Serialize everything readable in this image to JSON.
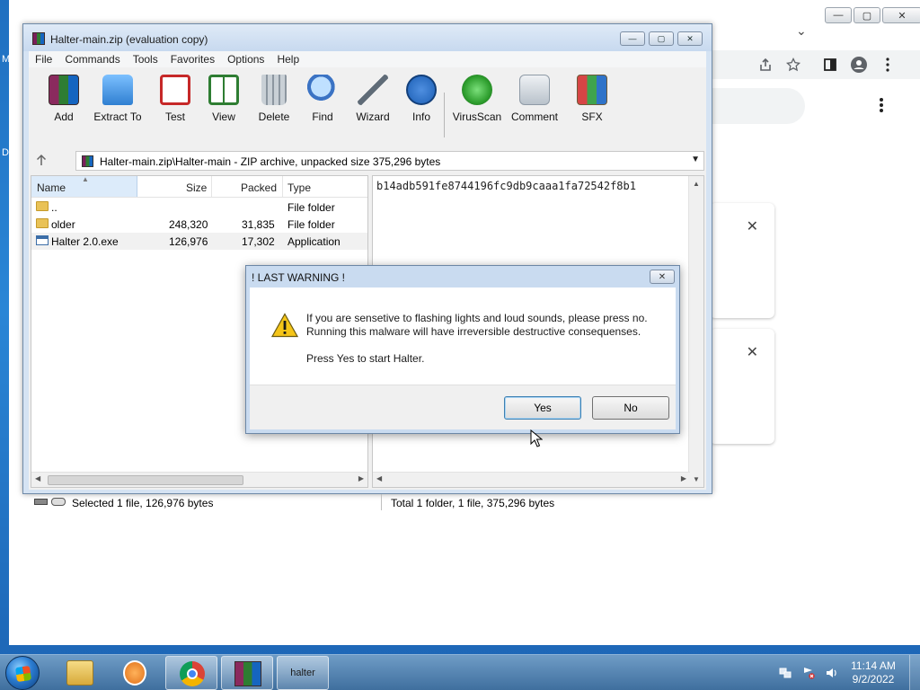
{
  "desktop": {
    "left_glyphs": [
      "M",
      "D"
    ]
  },
  "chrome": {
    "caption": {
      "minimize": "—",
      "maximize": "▢",
      "close": "✕"
    },
    "tab_strip_chevron": "⌄",
    "toolbar_icons": [
      "share-icon",
      "star-icon",
      "side-panel-icon",
      "profile-icon",
      "kebab-menu-icon"
    ],
    "cards": [
      {
        "close": "✕"
      },
      {
        "close": "✕"
      }
    ]
  },
  "winrar": {
    "title": "Halter-main.zip (evaluation copy)",
    "caption": {
      "minimize": "—",
      "maximize": "▢",
      "close": "✕"
    },
    "menu": [
      "File",
      "Commands",
      "Tools",
      "Favorites",
      "Options",
      "Help"
    ],
    "toolbar": [
      {
        "label": "Add",
        "icon": "archive-add-icon",
        "color": "#8a2a5e"
      },
      {
        "label": "Extract To",
        "icon": "folder-extract-icon",
        "color": "#2f7fd1"
      },
      {
        "label": "Test",
        "icon": "test-clipboard-icon",
        "color": "#c62828"
      },
      {
        "label": "View",
        "icon": "book-view-icon",
        "color": "#2e7d32"
      },
      {
        "label": "Delete",
        "icon": "trash-icon",
        "color": "#8c96a0"
      },
      {
        "label": "Find",
        "icon": "magnifier-icon",
        "color": "#3b73c4"
      },
      {
        "label": "Wizard",
        "icon": "wand-icon",
        "color": "#9aa7b3"
      },
      {
        "label": "Info",
        "icon": "info-icon",
        "color": "#1c5fb5"
      },
      {
        "label": "VirusScan",
        "icon": "virus-scan-icon",
        "color": "#2e9e2e"
      },
      {
        "label": "Comment",
        "icon": "comment-icon",
        "color": "#8e9aa6"
      },
      {
        "label": "SFX",
        "icon": "sfx-box-icon",
        "color": "#d64545"
      }
    ],
    "path": "Halter-main.zip\\Halter-main - ZIP archive, unpacked size 375,296 bytes",
    "columns": {
      "name": "Name",
      "size": "Size",
      "packed": "Packed",
      "type": "Type"
    },
    "files": [
      {
        "name": "..",
        "size": "",
        "packed": "",
        "type": "File folder",
        "kind": "folder"
      },
      {
        "name": "older",
        "size": "248,320",
        "packed": "31,835",
        "type": "File folder",
        "kind": "folder"
      },
      {
        "name": "Halter 2.0.exe",
        "size": "126,976",
        "packed": "17,302",
        "type": "Application",
        "kind": "exe"
      }
    ],
    "comment": "b14adb591fe8744196fc9db9caaa1fa72542f8b1",
    "status_left": "Selected 1 file, 126,976 bytes",
    "status_right": "Total 1 folder, 1 file, 375,296 bytes"
  },
  "dialog": {
    "title": "! LAST WARNING !",
    "line1": "If you are sensetive to flashing lights and loud sounds, please press no.",
    "line2": "Running this malware will have irreversible destructive consequenses.",
    "line3": "Press Yes to start Halter.",
    "yes": "Yes",
    "no": "No",
    "close": "✕"
  },
  "taskbar": {
    "items": [
      "explorer",
      "media-player",
      "chrome",
      "winrar",
      "halter"
    ],
    "halter_label": "halter",
    "time": "11:14 AM",
    "date": "9/2/2022"
  }
}
